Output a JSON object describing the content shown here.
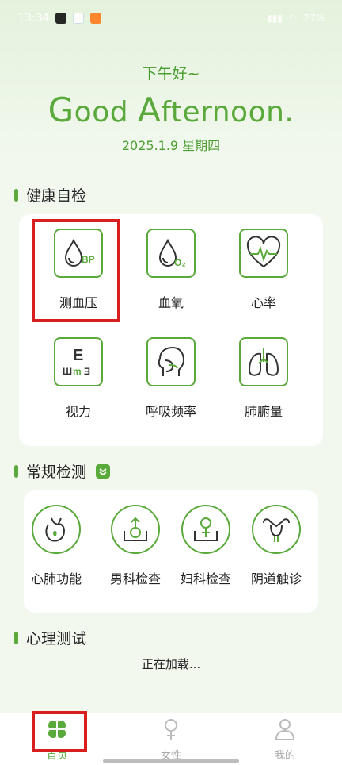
{
  "status_bar": {
    "time": "13:34",
    "battery": "27%"
  },
  "hero": {
    "greeting_cn": "下午好~",
    "greeting_en_first": "G",
    "greeting_en_mid": "ood ",
    "greeting_en_A": "A",
    "greeting_en_rest": "fternoon.",
    "date": "2025.1.9 星期四"
  },
  "health_check": {
    "title": "健康自检",
    "items": [
      {
        "label": "测血压",
        "icon": "blood-pressure-icon"
      },
      {
        "label": "血氧",
        "icon": "blood-oxygen-icon"
      },
      {
        "label": "心率",
        "icon": "heart-rate-icon"
      },
      {
        "label": "视力",
        "icon": "eye-chart-icon"
      },
      {
        "label": "呼吸频率",
        "icon": "head-breath-icon"
      },
      {
        "label": "肺腑量",
        "icon": "lungs-icon"
      }
    ]
  },
  "routine": {
    "title": "常规检测",
    "items": [
      {
        "label": "心肺功能",
        "icon": "heart-lung-icon"
      },
      {
        "label": "男科检查",
        "icon": "male-icon"
      },
      {
        "label": "妇科检查",
        "icon": "female-icon"
      },
      {
        "label": "阴道触诊",
        "icon": "uterus-icon"
      }
    ]
  },
  "psych": {
    "title": "心理测试",
    "loading": "正在加载..."
  },
  "tabs": [
    {
      "label": "首页",
      "icon": "clover-icon",
      "active": true
    },
    {
      "label": "女性",
      "icon": "female-symbol-icon",
      "active": false
    },
    {
      "label": "我的",
      "icon": "person-icon",
      "active": false
    }
  ],
  "colors": {
    "accent": "#5aa93b",
    "highlight": "#d81e1e"
  }
}
